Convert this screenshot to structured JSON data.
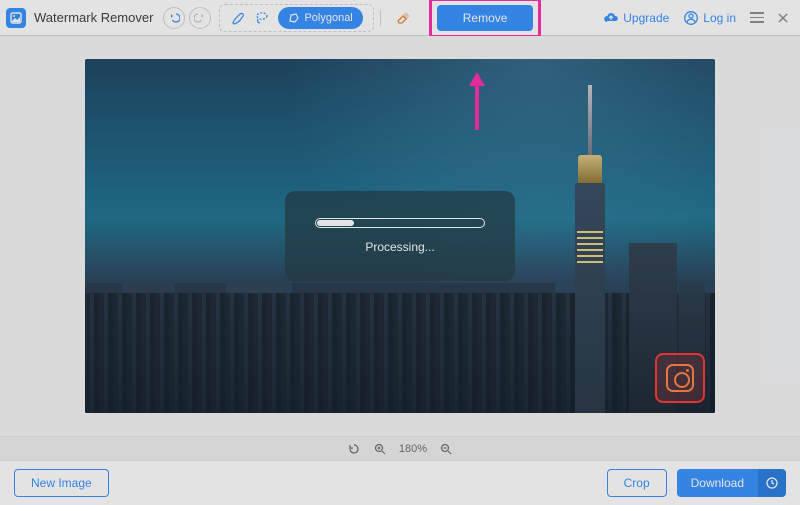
{
  "app": {
    "title": "Watermark Remover"
  },
  "toolbar": {
    "polygonal_label": "Polygonal",
    "remove_label": "Remove",
    "upgrade_label": "Upgrade",
    "login_label": "Log in"
  },
  "processing": {
    "status_label": "Processing..."
  },
  "zoom": {
    "level": "180%"
  },
  "footer": {
    "new_image_label": "New Image",
    "crop_label": "Crop",
    "download_label": "Download"
  },
  "icons": {
    "undo": "undo-icon",
    "redo": "redo-icon",
    "brush": "brush-icon",
    "lasso": "lasso-icon",
    "polygonal": "polygonal-icon",
    "eraser": "eraser-icon",
    "upgrade": "cloud-up-icon",
    "user": "user-icon",
    "menu": "menu-icon",
    "close": "close-icon",
    "rotate": "rotate-icon",
    "zoom_in": "zoom-in-icon",
    "zoom_out": "zoom-out-icon",
    "clock": "clock-icon"
  },
  "colors": {
    "accent": "#2a8cff",
    "highlight": "#ff1fa8"
  }
}
